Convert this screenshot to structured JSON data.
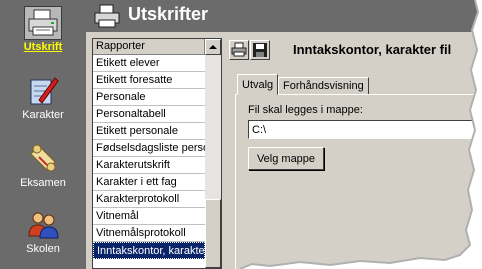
{
  "header": {
    "title": "Utskrifter",
    "icon": "printer-icon"
  },
  "nav": {
    "items": [
      {
        "label": "Utskrift",
        "icon": "printer-icon",
        "active": true
      },
      {
        "label": "Karakter",
        "icon": "pen-notepad-icon"
      },
      {
        "label": "Eksamen",
        "icon": "diploma-scroll-icon"
      },
      {
        "label": "Skolen",
        "icon": "people-icon"
      }
    ]
  },
  "reports": {
    "header": "Rapporter",
    "items": [
      "Etikett elever",
      "Etikett foresatte",
      "Personale",
      "Personaltabell",
      "Etikett personale",
      "Fødselsdagsliste persor",
      "Karakterutskrift",
      "Karakter i ett fag",
      "Karakterprotokoll",
      "Vitnemål",
      "Vitnemålsprotokoll",
      "Inntakskontor, karakter"
    ],
    "selected_index": 11
  },
  "pane": {
    "title": "Inntakskontor, karakter fil",
    "toolbar": [
      "printer-icon",
      "save-disk-icon"
    ],
    "tabs": [
      "Utvalg",
      "Forhåndsvisning"
    ],
    "active_tab": "Utvalg",
    "field_label": "Fil skal legges i mappe:",
    "folder_value": "C:\\",
    "choose_button": "Velg mappe"
  },
  "colors": {
    "nav_bg": "#6b6b6b",
    "nav_active_label": "#ffff00",
    "window_bg": "#d4d0c8",
    "selection": "#0a246a"
  }
}
